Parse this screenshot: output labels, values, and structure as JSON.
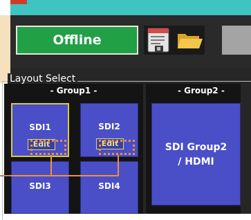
{
  "toolbar": {
    "offline_label": "Offline",
    "save_icon": "save-sheet-icon",
    "open_icon": "folder-open-icon"
  },
  "layout_select": {
    "legend": "Layout Select",
    "groups": [
      {
        "title": "- Group1 -",
        "tiles": [
          {
            "label": "SDI1",
            "edit_label": "Edit",
            "selected": true
          },
          {
            "label": "SDI2",
            "edit_label": "Edit",
            "selected": false
          },
          {
            "label": "SDI3"
          },
          {
            "label": "SDI4"
          }
        ]
      },
      {
        "title": "- Group2 -",
        "tiles": [
          {
            "line1": "SDI Group2",
            "line2": "/ HDMI"
          }
        ]
      }
    ]
  },
  "colors": {
    "accent_cyan": "#3fc4c2",
    "offline_green": "#21a046",
    "tile_blue": "#4a4fc8",
    "selected_border": "#d9cc3a",
    "highlight_orange": "#f0913a",
    "callout_bg": "#f7e0bd"
  }
}
